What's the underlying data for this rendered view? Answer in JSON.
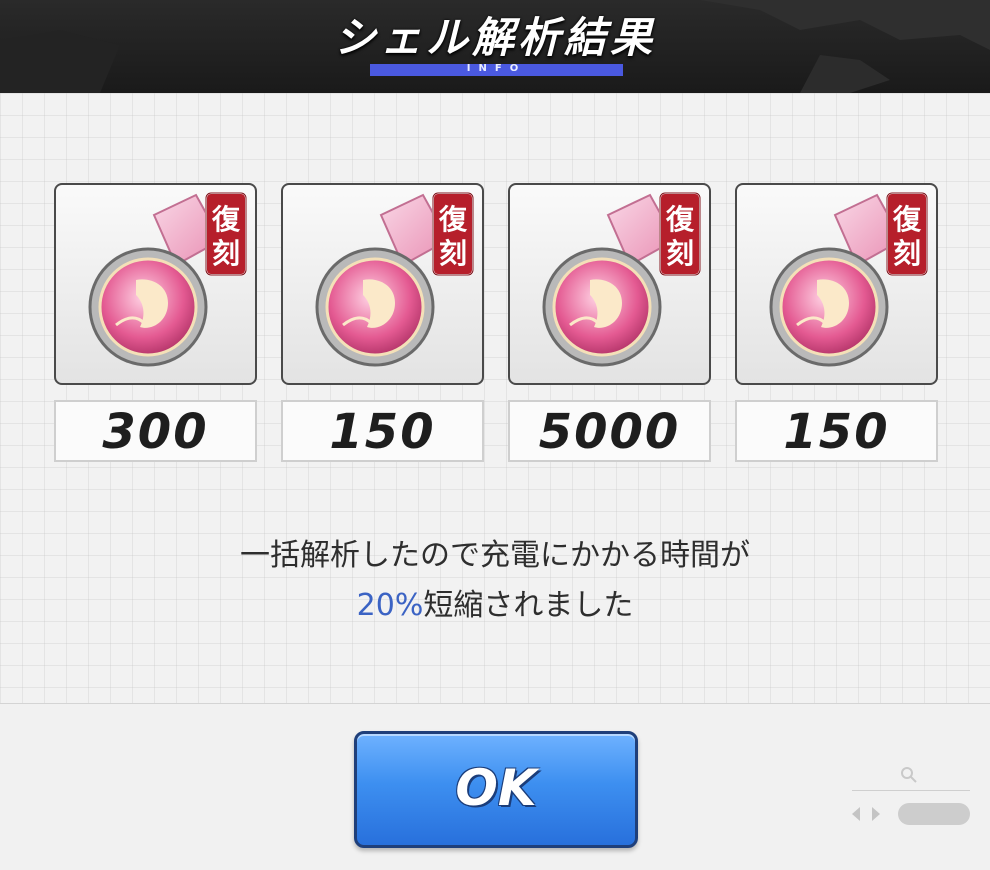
{
  "header": {
    "title": "シェル解析結果",
    "subtitle": "INFO",
    "accent_color": "#4a59e0"
  },
  "items": [
    {
      "icon": "pink-medal-icon",
      "badge": "復刻",
      "count": "300"
    },
    {
      "icon": "pink-medal-icon",
      "badge": "復刻",
      "count": "150"
    },
    {
      "icon": "pink-medal-icon",
      "badge": "復刻",
      "count": "5000"
    },
    {
      "icon": "pink-medal-icon",
      "badge": "復刻",
      "count": "150"
    }
  ],
  "message": {
    "line1": "一括解析したので充電にかかる時間が",
    "percent": "20%",
    "line2_rest": "短縮されました",
    "percent_color": "#3b63c4"
  },
  "ok_button": {
    "label": "OK",
    "color": "#3d8ff0"
  }
}
